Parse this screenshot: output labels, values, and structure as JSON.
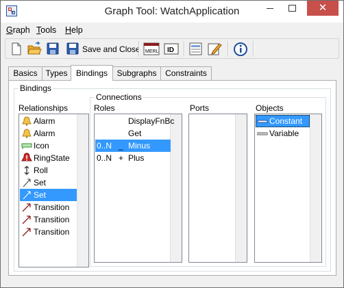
{
  "window": {
    "title": "Graph Tool: WatchApplication",
    "close_glyph": "✕"
  },
  "menu": [
    {
      "label": "Graph",
      "u": "G",
      "rest": "raph"
    },
    {
      "label": "Tools",
      "u": "T",
      "rest": "ools"
    },
    {
      "label": "Help",
      "u": "H",
      "rest": "elp"
    }
  ],
  "toolbar": {
    "save_close_label": "Save and Close",
    "icons": [
      "new-document-icon",
      "open-folder-icon",
      "save-icon",
      "save-and-close-icon",
      "merl-icon",
      "id-icon",
      "properties-icon",
      "edit-icon",
      "info-icon"
    ],
    "merl_text": "MERL",
    "id_text": "ID"
  },
  "tabs": [
    "Basics",
    "Types",
    "Bindings",
    "Subgraphs",
    "Constraints"
  ],
  "active_tab": "Bindings",
  "bindings": {
    "group_title": "Bindings",
    "relationships_label": "Relationships",
    "relationships": [
      {
        "label": "Alarm",
        "icon": "bell-icon"
      },
      {
        "label": "Alarm",
        "icon": "bell-icon"
      },
      {
        "label": "Icon",
        "icon": "icon-shape-icon"
      },
      {
        "label": "RingState",
        "icon": "red-bell-icon"
      },
      {
        "label": "Roll",
        "icon": "roll-arrows-icon"
      },
      {
        "label": "Set",
        "icon": "set-arrow-icon"
      },
      {
        "label": "Set",
        "icon": "set-arrow-icon",
        "selected": true
      },
      {
        "label": "Transition",
        "icon": "transition-arrow-icon"
      },
      {
        "label": "Transition",
        "icon": "transition-arrow-icon"
      },
      {
        "label": "Transition",
        "icon": "transition-arrow-icon"
      }
    ],
    "connections_title": "Connections",
    "roles_label": "Roles",
    "roles": [
      {
        "card": "",
        "sym": "",
        "label": "DisplayFnBc"
      },
      {
        "card": "",
        "sym": "",
        "label": "Get"
      },
      {
        "card": "0..N",
        "sym": "_",
        "label": "Minus",
        "selected": true
      },
      {
        "card": "0..N",
        "sym": "+",
        "label": "Plus"
      }
    ],
    "ports_label": "Ports",
    "objects_label": "Objects",
    "objects": [
      {
        "label": "Constant",
        "icon": "constant-icon",
        "selected": true
      },
      {
        "label": "Variable",
        "icon": "variable-icon"
      }
    ]
  },
  "colors": {
    "selection": "#3399ff",
    "close_button": "#c7504b"
  }
}
